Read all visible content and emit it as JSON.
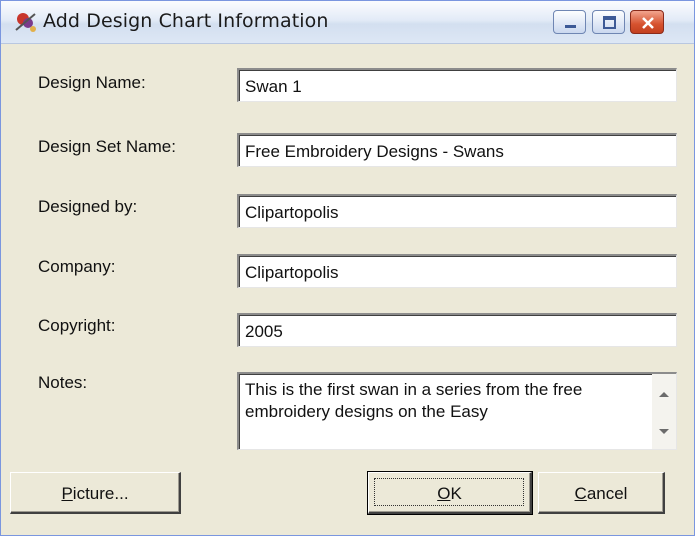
{
  "window": {
    "title": "Add Design Chart Information"
  },
  "form": {
    "design_name": {
      "label": "Design Name:",
      "value": "Swan 1"
    },
    "design_set_name": {
      "label": "Design Set Name:",
      "value": "Free Embroidery Designs - Swans"
    },
    "designed_by": {
      "label": "Designed by:",
      "value": "Clipartopolis"
    },
    "company": {
      "label": "Company:",
      "value": "Clipartopolis"
    },
    "copyright": {
      "label": "Copyright:",
      "value": "2005"
    },
    "notes": {
      "label": "Notes:",
      "value": "This is the first swan in a series from the free embroidery designs on the Easy"
    }
  },
  "buttons": {
    "picture": {
      "label_mnemonic": "P",
      "label_rest": "icture..."
    },
    "ok": {
      "label_mnemonic": "O",
      "label_rest": "K"
    },
    "cancel": {
      "label_mnemonic": "C",
      "label_rest": "ancel"
    }
  },
  "icons": {
    "app": "embroidery-app-icon",
    "minimize": "minimize-icon",
    "maximize": "maximize-icon",
    "close": "close-icon",
    "scroll_up": "scroll-up-icon",
    "scroll_down": "scroll-down-icon"
  },
  "colors": {
    "dialog_bg": "#ece9d8",
    "close_button": "#d6522f",
    "titlebar": "#e3ebf7"
  }
}
